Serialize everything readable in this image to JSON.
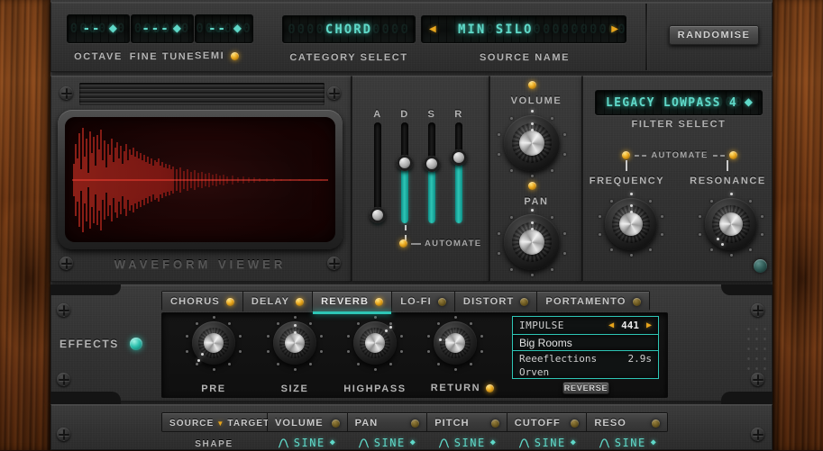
{
  "top_bar": {
    "spinners": [
      {
        "label": "OCTAVE",
        "value": "--",
        "ghost": "000000"
      },
      {
        "label": "FINE TUNE",
        "value": "---",
        "ghost": "000000"
      },
      {
        "label": "SEMI",
        "value": "--",
        "ghost": "000000",
        "led": "on"
      }
    ],
    "category": {
      "label": "CATEGORY SELECT",
      "value": "CHORD",
      "ghost": "0000000000000"
    },
    "source": {
      "label": "SOURCE NAME",
      "value": "MIN SILO",
      "ghost": "00000000000000000000000",
      "prev_icon": "left-arrow-icon",
      "next_icon": "right-arrow-icon"
    },
    "randomise": "RANDOMISE"
  },
  "waveform": {
    "title": "WAVEFORM VIEWER",
    "color": "#e03030"
  },
  "adsr": {
    "labels": [
      "A",
      "D",
      "S",
      "R"
    ],
    "values": [
      0.06,
      0.72,
      0.74,
      0.82
    ],
    "automate_label": "AUTOMATE",
    "automate_led": "on",
    "fill_color": "#2ec6b6"
  },
  "amp": {
    "volume": {
      "label": "VOLUME",
      "led": "on",
      "angle": -4
    },
    "pan": {
      "label": "PAN",
      "led": "on",
      "angle": -4
    }
  },
  "filter": {
    "select_label": "FILTER SELECT",
    "select_value": "LEGACY LOWPASS 4",
    "select_ghost": "000000",
    "automate_label": "AUTOMATE",
    "knobs": [
      {
        "label": "FREQUENCY",
        "led": "on",
        "angle": -6
      },
      {
        "label": "RESONANCE",
        "led": "on",
        "angle": -128
      }
    ],
    "power_led": "tealdim"
  },
  "effects": {
    "section_label": "EFFECTS",
    "section_led": "teal",
    "tabs": [
      {
        "label": "CHORUS",
        "led": "on",
        "active": false
      },
      {
        "label": "DELAY",
        "led": "on",
        "active": false
      },
      {
        "label": "REVERB",
        "led": "on",
        "active": true
      },
      {
        "label": "LO-FI",
        "led": "dim",
        "active": false
      },
      {
        "label": "DISTORT",
        "led": "dim",
        "active": false
      },
      {
        "label": "PORTAMENTO",
        "led": "dim",
        "active": false
      }
    ],
    "knobs": [
      {
        "label": "PRE",
        "angle": -140,
        "led": null
      },
      {
        "label": "SIZE",
        "angle": 0,
        "led": null
      },
      {
        "label": "HIGHPASS",
        "angle": 42,
        "led": null
      },
      {
        "label": "RETURN",
        "angle": -72,
        "led": "on"
      }
    ],
    "impulse": {
      "header_label": "IMPULSE",
      "header_value": "441",
      "prev_icon": "left-arrow-icon",
      "next_icon": "right-arrow-icon",
      "category": "Big Rooms",
      "items": [
        {
          "name": "Reeeflections",
          "time": "2.9s"
        },
        {
          "name": "Orven",
          "time": ""
        }
      ],
      "reverse_button": "REVERSE"
    }
  },
  "mod_matrix": {
    "source_label": "SOURCE",
    "target_label": "TARGET",
    "columns": [
      {
        "label": "VOLUME",
        "led": "dim"
      },
      {
        "label": "PAN",
        "led": "dim"
      },
      {
        "label": "PITCH",
        "led": "dim"
      },
      {
        "label": "CUTOFF",
        "led": "dim"
      },
      {
        "label": "RESO",
        "led": "dim"
      }
    ],
    "shape_row_label": "SHAPE",
    "shape_values": [
      "SINE",
      "SINE",
      "SINE",
      "SINE",
      "SINE"
    ]
  }
}
